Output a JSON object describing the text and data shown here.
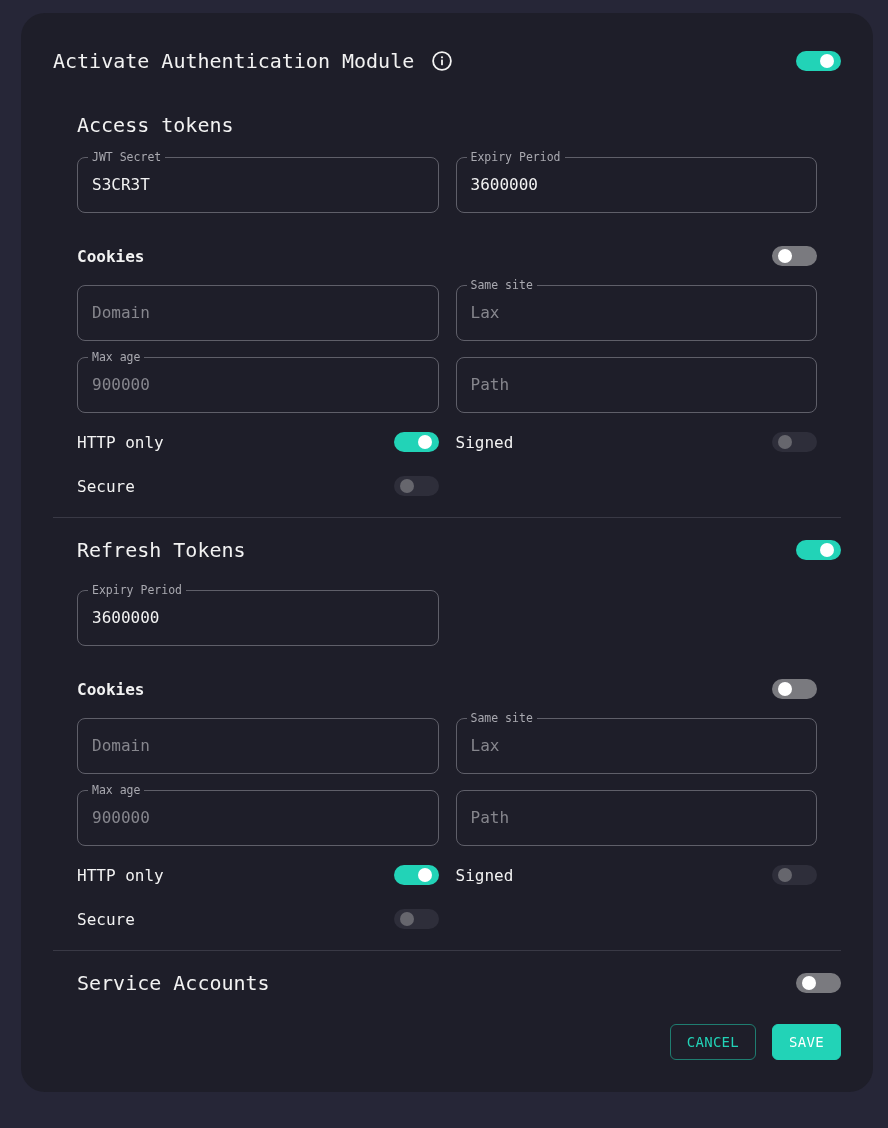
{
  "header": {
    "title": "Activate Authentication Module",
    "toggle": {
      "on": true,
      "disabled": false
    }
  },
  "sections": [
    {
      "title": "Access tokens",
      "fields": [
        {
          "label": "JWT Secret",
          "value": "S3CR3T"
        },
        {
          "label": "Expiry Period",
          "value": "3600000"
        }
      ],
      "cookies": {
        "title": "Cookies",
        "toggle": {
          "on": false,
          "disabled": false
        },
        "fields": [
          {
            "placeholder": "Domain"
          },
          {
            "label": "Same site",
            "placeholder": "Lax"
          },
          {
            "label": "Max age",
            "placeholder": "900000"
          },
          {
            "placeholder": "Path"
          }
        ],
        "switches": [
          {
            "label": "HTTP only",
            "on": true,
            "disabled": false
          },
          {
            "label": "Signed",
            "on": false,
            "disabled": true
          },
          {
            "label": "Secure",
            "on": false,
            "disabled": true
          }
        ]
      }
    },
    {
      "title": "Refresh Tokens",
      "toggle": {
        "on": true,
        "disabled": false
      },
      "fields": [
        {
          "label": "Expiry Period",
          "value": "3600000"
        }
      ],
      "cookies": {
        "title": "Cookies",
        "toggle": {
          "on": false,
          "disabled": false
        },
        "fields": [
          {
            "placeholder": "Domain"
          },
          {
            "label": "Same site",
            "placeholder": "Lax"
          },
          {
            "label": "Max age",
            "placeholder": "900000"
          },
          {
            "placeholder": "Path"
          }
        ],
        "switches": [
          {
            "label": "HTTP only",
            "on": true,
            "disabled": false
          },
          {
            "label": "Signed",
            "on": false,
            "disabled": true
          },
          {
            "label": "Secure",
            "on": false,
            "disabled": true
          }
        ]
      }
    },
    {
      "title": "Service Accounts",
      "toggle": {
        "on": false,
        "disabled": false
      }
    }
  ],
  "buttons": [
    {
      "label": "CANCEL",
      "kind": "outlined"
    },
    {
      "label": "SAVE",
      "kind": "filled"
    }
  ]
}
